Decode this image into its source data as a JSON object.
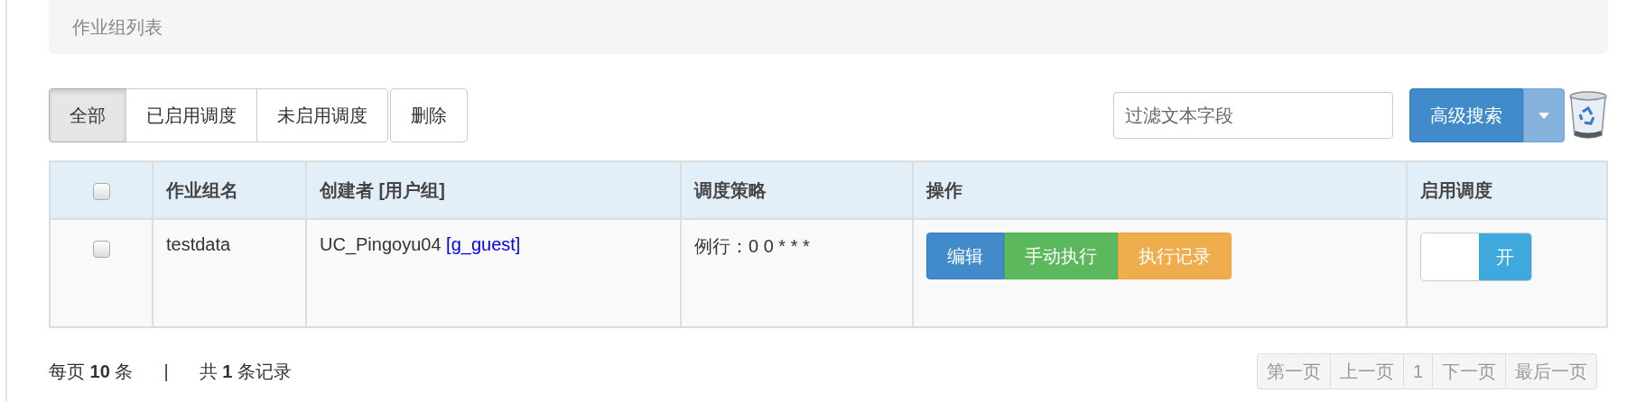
{
  "panel": {
    "title": "作业组列表"
  },
  "filter_tabs": [
    {
      "label": "全部",
      "selected": true
    },
    {
      "label": "已启用调度",
      "selected": false
    },
    {
      "label": "未启用调度",
      "selected": false
    }
  ],
  "delete_button": "删除",
  "search": {
    "placeholder": "过滤文本字段"
  },
  "advanced_search_button": "高级搜索",
  "table": {
    "select_all_checked": false,
    "columns": [
      "作业组名",
      "创建者 [用户组]",
      "调度策略",
      "操作",
      "启用调度"
    ],
    "rows": [
      {
        "checked": false,
        "name": "testdata",
        "creator": "UC_Pingoyu04",
        "group": "[g_guest]",
        "strategy": "例行：0 0 * * *",
        "actions": [
          {
            "label": "编辑",
            "kind": "primary"
          },
          {
            "label": "手动执行",
            "kind": "success"
          },
          {
            "label": "执行记录",
            "kind": "warning"
          }
        ],
        "schedule": {
          "on": true,
          "label": "开"
        }
      }
    ]
  },
  "footer": {
    "per_page": "每页 **10** 条",
    "separator": "|",
    "total": "共 **1** 条记录"
  },
  "pagination": [
    {
      "label": "第一页",
      "disabled": true
    },
    {
      "label": "上一页",
      "disabled": true
    },
    {
      "label": "1",
      "disabled": true
    },
    {
      "label": "下一页",
      "disabled": true
    },
    {
      "label": "最后一页",
      "disabled": true
    }
  ]
}
